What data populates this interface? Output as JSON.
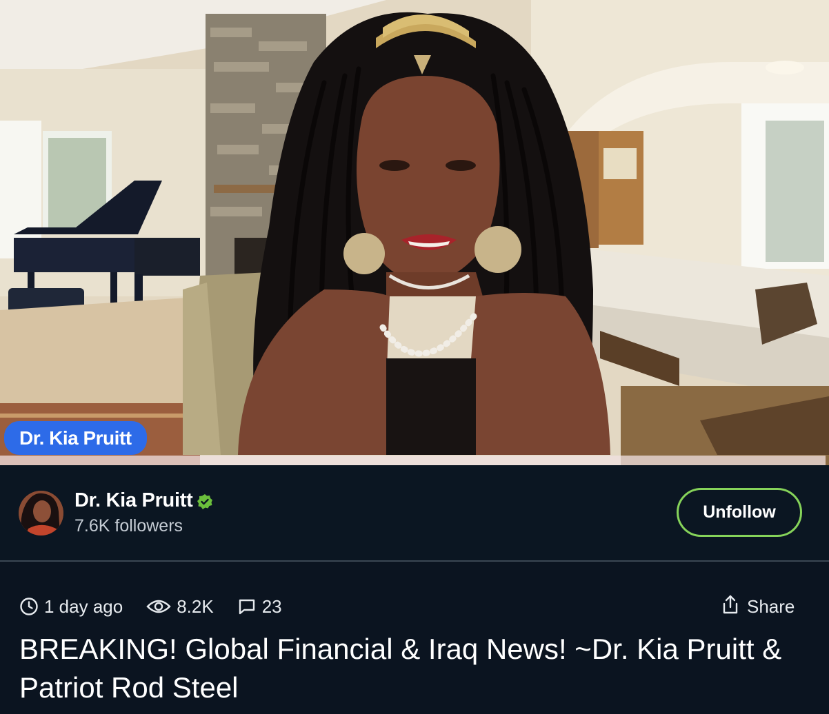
{
  "video": {
    "name_tag": "Dr. Kia Pruitt"
  },
  "channel": {
    "name": "Dr. Kia Pruitt",
    "followers": "7.6K followers",
    "follow_button_label": "Unfollow",
    "verified": true,
    "verified_color": "#6bbf3c",
    "button_border_color": "#86d35a"
  },
  "meta": {
    "posted": "1 day ago",
    "views": "8.2K",
    "comments": "23",
    "share_label": "Share"
  },
  "title": "BREAKING! Global Financial & Iraq News! ~Dr. Kia Pruitt & Patriot Rod Steel",
  "icons": {
    "clock": "clock-icon",
    "views": "eye-icon",
    "comments": "comment-icon",
    "share": "share-icon",
    "verified": "check-badge-icon"
  },
  "colors": {
    "background": "#0b1622",
    "name_tag": "#2d6be8",
    "divider": "#3b4753"
  }
}
